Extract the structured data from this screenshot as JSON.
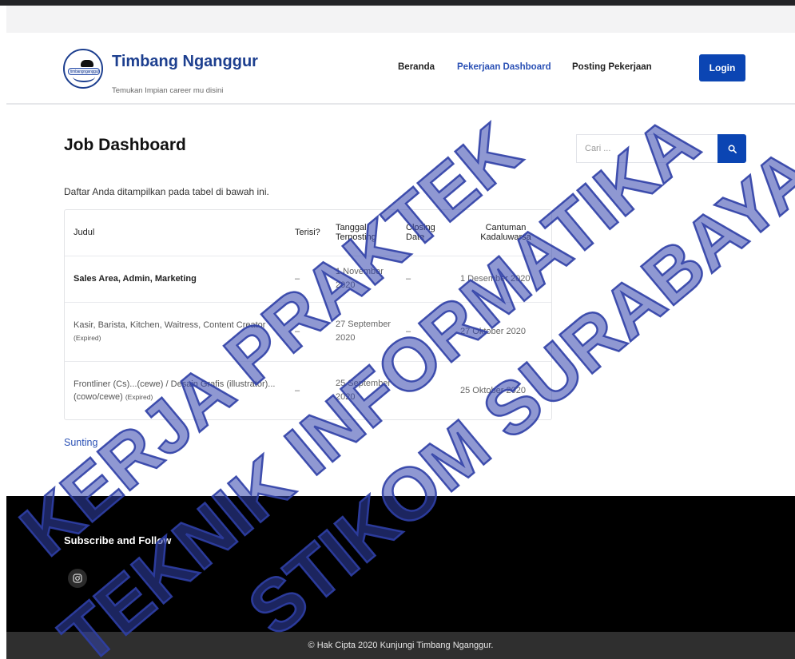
{
  "header": {
    "site_title": "Timbang Nganggur",
    "tagline": "Temukan Impian career mu disini",
    "logo_text": "timbangnganggur",
    "nav": {
      "home": "Beranda",
      "dashboard": "Pekerjaan Dashboard",
      "post_job": "Posting Pekerjaan"
    },
    "login_label": "Login"
  },
  "main": {
    "title": "Job Dashboard",
    "intro": "Daftar Anda ditampilkan pada tabel di bawah ini.",
    "search_placeholder": "Cari ...",
    "table": {
      "headers": {
        "title": "Judul",
        "filled": "Terisi?",
        "posted": "Tanggal Terposting",
        "closing": "Closing Date",
        "expires": "Cantuman Kadaluwarsa"
      },
      "rows": [
        {
          "title": "Sales Area, Admin, Marketing",
          "status": "",
          "filled": "–",
          "posted": "1 November 2020",
          "closing": "–",
          "expires": "1 Desember 2020"
        },
        {
          "title": "Kasir, Barista, Kitchen, Waitress, Content Creator",
          "status": "(Expired)",
          "filled": "–",
          "posted": "27 September 2020",
          "closing": "–",
          "expires": "27 Oktober 2020"
        },
        {
          "title": "Frontliner (Cs)...(cewe) / Desain Grafis (illustrator)... (cowo/cewe)",
          "status": "(Expired)",
          "filled": "–",
          "posted": "25 September 2020",
          "closing": "–",
          "expires": "25 Oktober 2020"
        }
      ]
    },
    "edit_link": "Sunting"
  },
  "footer": {
    "title": "Subscribe and Follow",
    "social_icon": "instagram-icon",
    "copyright": "© Hak Cipta 2020 Kunjungi Timbang Nganggur."
  },
  "watermark": {
    "line1": "KERJA PRAKTEK",
    "line2": "TEKNIK INFORMATIKA",
    "line3": "STIKOM SURABAYA",
    "color": "#2f3fa6"
  },
  "colors": {
    "brand": "#1d3f8f",
    "accent": "#0b45b3",
    "link": "#2a50b5",
    "footer_bg": "#000000"
  }
}
